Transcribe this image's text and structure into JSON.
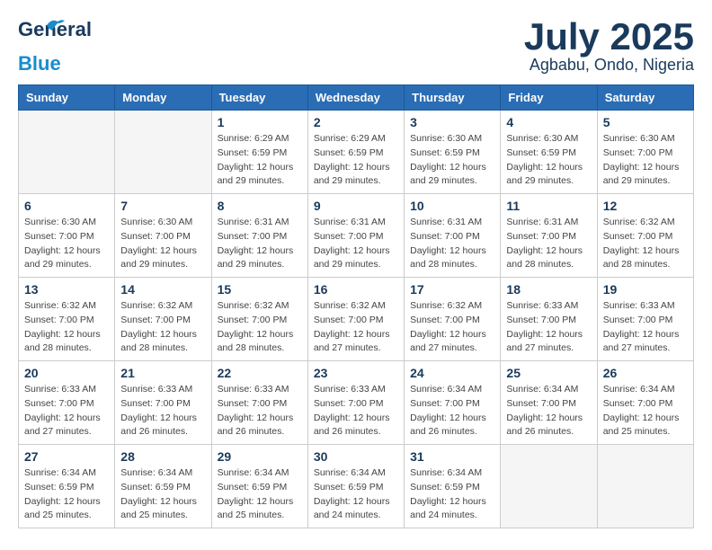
{
  "logo": {
    "general": "General",
    "blue": "Blue"
  },
  "header": {
    "month": "July 2025",
    "location": "Agbabu, Ondo, Nigeria"
  },
  "weekdays": [
    "Sunday",
    "Monday",
    "Tuesday",
    "Wednesday",
    "Thursday",
    "Friday",
    "Saturday"
  ],
  "weeks": [
    [
      {
        "day": "",
        "info": ""
      },
      {
        "day": "",
        "info": ""
      },
      {
        "day": "1",
        "info": "Sunrise: 6:29 AM\nSunset: 6:59 PM\nDaylight: 12 hours\nand 29 minutes."
      },
      {
        "day": "2",
        "info": "Sunrise: 6:29 AM\nSunset: 6:59 PM\nDaylight: 12 hours\nand 29 minutes."
      },
      {
        "day": "3",
        "info": "Sunrise: 6:30 AM\nSunset: 6:59 PM\nDaylight: 12 hours\nand 29 minutes."
      },
      {
        "day": "4",
        "info": "Sunrise: 6:30 AM\nSunset: 6:59 PM\nDaylight: 12 hours\nand 29 minutes."
      },
      {
        "day": "5",
        "info": "Sunrise: 6:30 AM\nSunset: 7:00 PM\nDaylight: 12 hours\nand 29 minutes."
      }
    ],
    [
      {
        "day": "6",
        "info": "Sunrise: 6:30 AM\nSunset: 7:00 PM\nDaylight: 12 hours\nand 29 minutes."
      },
      {
        "day": "7",
        "info": "Sunrise: 6:30 AM\nSunset: 7:00 PM\nDaylight: 12 hours\nand 29 minutes."
      },
      {
        "day": "8",
        "info": "Sunrise: 6:31 AM\nSunset: 7:00 PM\nDaylight: 12 hours\nand 29 minutes."
      },
      {
        "day": "9",
        "info": "Sunrise: 6:31 AM\nSunset: 7:00 PM\nDaylight: 12 hours\nand 29 minutes."
      },
      {
        "day": "10",
        "info": "Sunrise: 6:31 AM\nSunset: 7:00 PM\nDaylight: 12 hours\nand 28 minutes."
      },
      {
        "day": "11",
        "info": "Sunrise: 6:31 AM\nSunset: 7:00 PM\nDaylight: 12 hours\nand 28 minutes."
      },
      {
        "day": "12",
        "info": "Sunrise: 6:32 AM\nSunset: 7:00 PM\nDaylight: 12 hours\nand 28 minutes."
      }
    ],
    [
      {
        "day": "13",
        "info": "Sunrise: 6:32 AM\nSunset: 7:00 PM\nDaylight: 12 hours\nand 28 minutes."
      },
      {
        "day": "14",
        "info": "Sunrise: 6:32 AM\nSunset: 7:00 PM\nDaylight: 12 hours\nand 28 minutes."
      },
      {
        "day": "15",
        "info": "Sunrise: 6:32 AM\nSunset: 7:00 PM\nDaylight: 12 hours\nand 28 minutes."
      },
      {
        "day": "16",
        "info": "Sunrise: 6:32 AM\nSunset: 7:00 PM\nDaylight: 12 hours\nand 27 minutes."
      },
      {
        "day": "17",
        "info": "Sunrise: 6:32 AM\nSunset: 7:00 PM\nDaylight: 12 hours\nand 27 minutes."
      },
      {
        "day": "18",
        "info": "Sunrise: 6:33 AM\nSunset: 7:00 PM\nDaylight: 12 hours\nand 27 minutes."
      },
      {
        "day": "19",
        "info": "Sunrise: 6:33 AM\nSunset: 7:00 PM\nDaylight: 12 hours\nand 27 minutes."
      }
    ],
    [
      {
        "day": "20",
        "info": "Sunrise: 6:33 AM\nSunset: 7:00 PM\nDaylight: 12 hours\nand 27 minutes."
      },
      {
        "day": "21",
        "info": "Sunrise: 6:33 AM\nSunset: 7:00 PM\nDaylight: 12 hours\nand 26 minutes."
      },
      {
        "day": "22",
        "info": "Sunrise: 6:33 AM\nSunset: 7:00 PM\nDaylight: 12 hours\nand 26 minutes."
      },
      {
        "day": "23",
        "info": "Sunrise: 6:33 AM\nSunset: 7:00 PM\nDaylight: 12 hours\nand 26 minutes."
      },
      {
        "day": "24",
        "info": "Sunrise: 6:34 AM\nSunset: 7:00 PM\nDaylight: 12 hours\nand 26 minutes."
      },
      {
        "day": "25",
        "info": "Sunrise: 6:34 AM\nSunset: 7:00 PM\nDaylight: 12 hours\nand 26 minutes."
      },
      {
        "day": "26",
        "info": "Sunrise: 6:34 AM\nSunset: 7:00 PM\nDaylight: 12 hours\nand 25 minutes."
      }
    ],
    [
      {
        "day": "27",
        "info": "Sunrise: 6:34 AM\nSunset: 6:59 PM\nDaylight: 12 hours\nand 25 minutes."
      },
      {
        "day": "28",
        "info": "Sunrise: 6:34 AM\nSunset: 6:59 PM\nDaylight: 12 hours\nand 25 minutes."
      },
      {
        "day": "29",
        "info": "Sunrise: 6:34 AM\nSunset: 6:59 PM\nDaylight: 12 hours\nand 25 minutes."
      },
      {
        "day": "30",
        "info": "Sunrise: 6:34 AM\nSunset: 6:59 PM\nDaylight: 12 hours\nand 24 minutes."
      },
      {
        "day": "31",
        "info": "Sunrise: 6:34 AM\nSunset: 6:59 PM\nDaylight: 12 hours\nand 24 minutes."
      },
      {
        "day": "",
        "info": ""
      },
      {
        "day": "",
        "info": ""
      }
    ]
  ]
}
